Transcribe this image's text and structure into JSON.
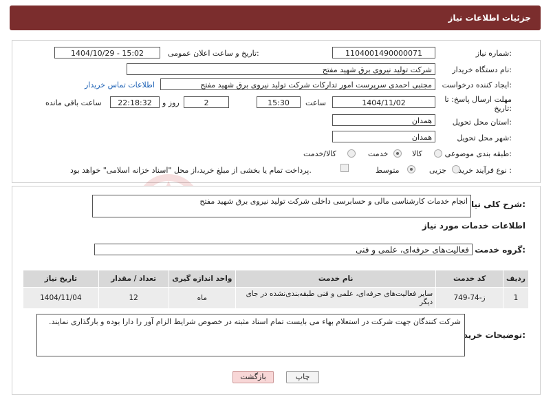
{
  "header": {
    "title": "جزئیات اطلاعات نیاز"
  },
  "need_number": {
    "label": "شماره نیاز:",
    "value": "1104001490000071"
  },
  "announce": {
    "label": "تاریخ و ساعت اعلان عمومی:",
    "value": "1404/10/29 - 15:02"
  },
  "buyer": {
    "label": "نام دستگاه خریدار:",
    "value": "شرکت تولید نیروی برق شهید مفتح"
  },
  "creator": {
    "label": "ایجاد کننده درخواست:",
    "value": "مجتبی احمدی سرپرست امور تدارکات شرکت تولید نیروی برق شهید مفتح",
    "contact_link": "اطلاعات تماس خریدار"
  },
  "deadline": {
    "label": "مهلت ارسال پاسخ: تا تاریخ:",
    "date": "1404/11/02",
    "time_label": "ساعت",
    "time": "15:30",
    "days": "2",
    "days_label": "روز و",
    "remaining": "22:18:32",
    "remaining_label": "ساعت باقی مانده"
  },
  "province": {
    "label": "استان محل تحویل:",
    "value": "همدان"
  },
  "city": {
    "label": "شهر محل تحویل:",
    "value": "همدان"
  },
  "category": {
    "label": "طبقه بندی موضوعی:",
    "options": [
      "کالا",
      "خدمت",
      "کالا/خدمت"
    ],
    "selected": "خدمت"
  },
  "process": {
    "label": "نوع فرآیند خرید :",
    "options": [
      "جزیی",
      "متوسط"
    ],
    "selected": "متوسط",
    "payment_note": "پرداخت تمام یا بخشی از مبلغ خرید،از محل \"اسناد خزانه اسلامی\" خواهد بود."
  },
  "description": {
    "label": "شرح کلی نیاز:",
    "value": "انجام خدمات کارشناسی مالی و حسابرسی داخلی شرکت تولید نیروی برق شهید مفتح"
  },
  "services_title": "اطلاعات خدمات مورد نیاز",
  "service_group": {
    "label": "گروه خدمت:",
    "value": "فعالیت‌های حرفه‌ای، علمی و فنی"
  },
  "table": {
    "headers": [
      "ردیف",
      "کد خدمت",
      "نام خدمت",
      "واحد اندازه گیری",
      "تعداد / مقدار",
      "تاریخ نیاز"
    ],
    "rows": [
      [
        "1",
        "ز-74-749",
        "سایر فعالیت‌های حرفه‌ای، علمی و فنی طبقه‌بندی‌نشده در جای دیگر",
        "ماه",
        "12",
        "1404/11/04"
      ]
    ]
  },
  "buyer_notes": {
    "label": "توضیحات خریدار:",
    "value": "شرکت کنندگان جهت شرکت در استعلام بهاء می بایست تمام اسناد مثبته در خصوص شرایط الزام آور را دارا بوده و بارگذاری نمایند."
  },
  "buttons": {
    "print": "چاپ",
    "back": "بازگشت"
  },
  "watermark": "AriaTender.neT"
}
